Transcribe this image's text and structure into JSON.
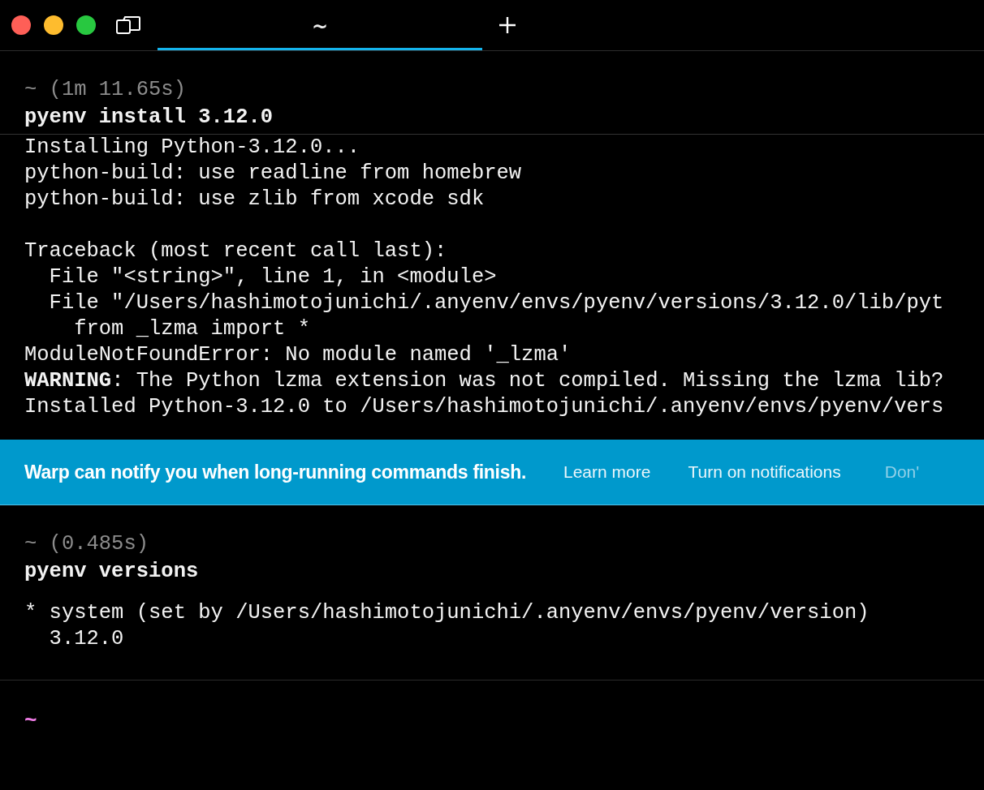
{
  "tabs": [
    {
      "label": "~",
      "selected": true
    }
  ],
  "sections": [
    {
      "kind": "block",
      "header": "~ (1m 11.65s)",
      "command": "pyenv install 3.12.0",
      "output": [
        [
          "Installing Python-3.12.0...",
          "python-build: use readline from homebrew",
          "python-build: use zlib from xcode sdk"
        ],
        [
          "Traceback (most recent call last):",
          "  File \"<string>\", line 1, in <module>",
          "  File \"/Users/hashimotojunichi/.anyenv/envs/pyenv/versions/3.12.0/lib/pyt",
          "    from _lzma import *",
          "ModuleNotFoundError: No module named '_lzma'",
          "**WARNING**: The Python lzma extension was not compiled. Missing the lzma lib?",
          "Installed Python-3.12.0 to /Users/hashimotojunichi/.anyenv/envs/pyenv/vers"
        ]
      ]
    },
    {
      "kind": "banner",
      "message": "Warp can notify you when long-running commands finish.",
      "actions": [
        {
          "label": "Learn more",
          "dimmed": false
        },
        {
          "label": "Turn on notifications",
          "dimmed": false
        },
        {
          "label": "Don'",
          "dimmed": true
        }
      ]
    },
    {
      "kind": "block",
      "header": "~ (0.485s)",
      "command": "pyenv versions",
      "output": [
        [
          "* system (set by /Users/hashimotojunichi/.anyenv/envs/pyenv/version)",
          "  3.12.0"
        ]
      ]
    },
    {
      "kind": "prompt",
      "text": "~"
    }
  ]
}
